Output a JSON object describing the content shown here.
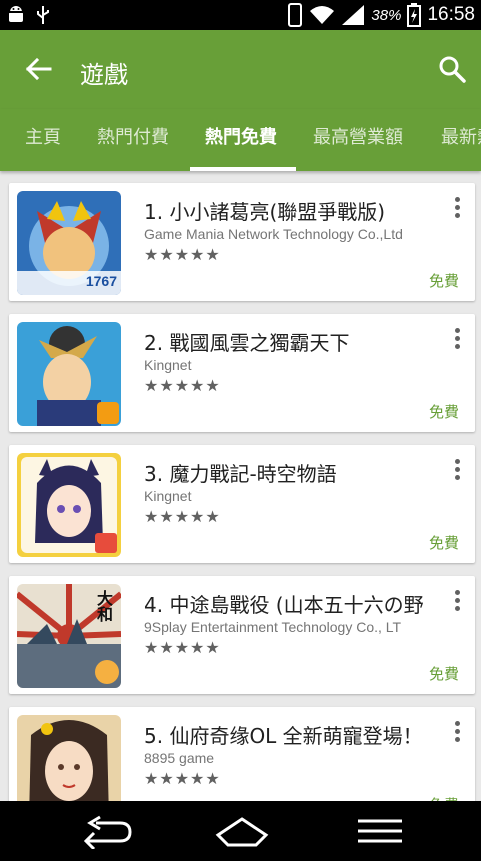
{
  "status_bar": {
    "battery": "38%",
    "time": "16:58",
    "icons": [
      "android-icon",
      "usb-icon",
      "phone-icon",
      "wifi-icon",
      "signal-icon",
      "battery-icon"
    ]
  },
  "app_bar": {
    "title": "遊戲",
    "back_icon": "arrow-back-icon",
    "search_icon": "search-icon",
    "color": "#689f38"
  },
  "tabs": [
    {
      "label": "主頁"
    },
    {
      "label": "熱門付費"
    },
    {
      "label": "熱門免費",
      "active": true
    },
    {
      "label": "最高營業額"
    },
    {
      "label": "最新熱"
    }
  ],
  "apps": [
    {
      "name": "1. 小小諸葛亮(聯盟爭戰版)",
      "developer": "Game Mania Network Technology Co.,Ltd",
      "rating": 4.5,
      "stars": "★★★★★",
      "price": "免費"
    },
    {
      "name": "2. 戰國風雲之獨霸天下",
      "developer": "Kingnet",
      "rating": 4.5,
      "stars": "★★★★★",
      "price": "免費"
    },
    {
      "name": "3. 魔力戰記-時空物語",
      "developer": "Kingnet",
      "rating": 4.5,
      "stars": "★★★★★",
      "price": "免費"
    },
    {
      "name": "4. 中途島戰役 (山本五十六の野",
      "developer": "9Splay Entertainment Technology Co., LT",
      "rating": 4.5,
      "stars": "★★★★★",
      "price": "免費"
    },
    {
      "name": "5. 仙府奇缘OL 全新萌寵登場！",
      "developer": "8895 game",
      "rating": 4.5,
      "stars": "★★★★★",
      "price": "免費"
    }
  ],
  "icon_badges": {
    "app1": "1767",
    "app4": "大和"
  },
  "nav_bar": {
    "icons": [
      "back-nav-icon",
      "home-nav-icon",
      "menu-nav-icon"
    ]
  }
}
